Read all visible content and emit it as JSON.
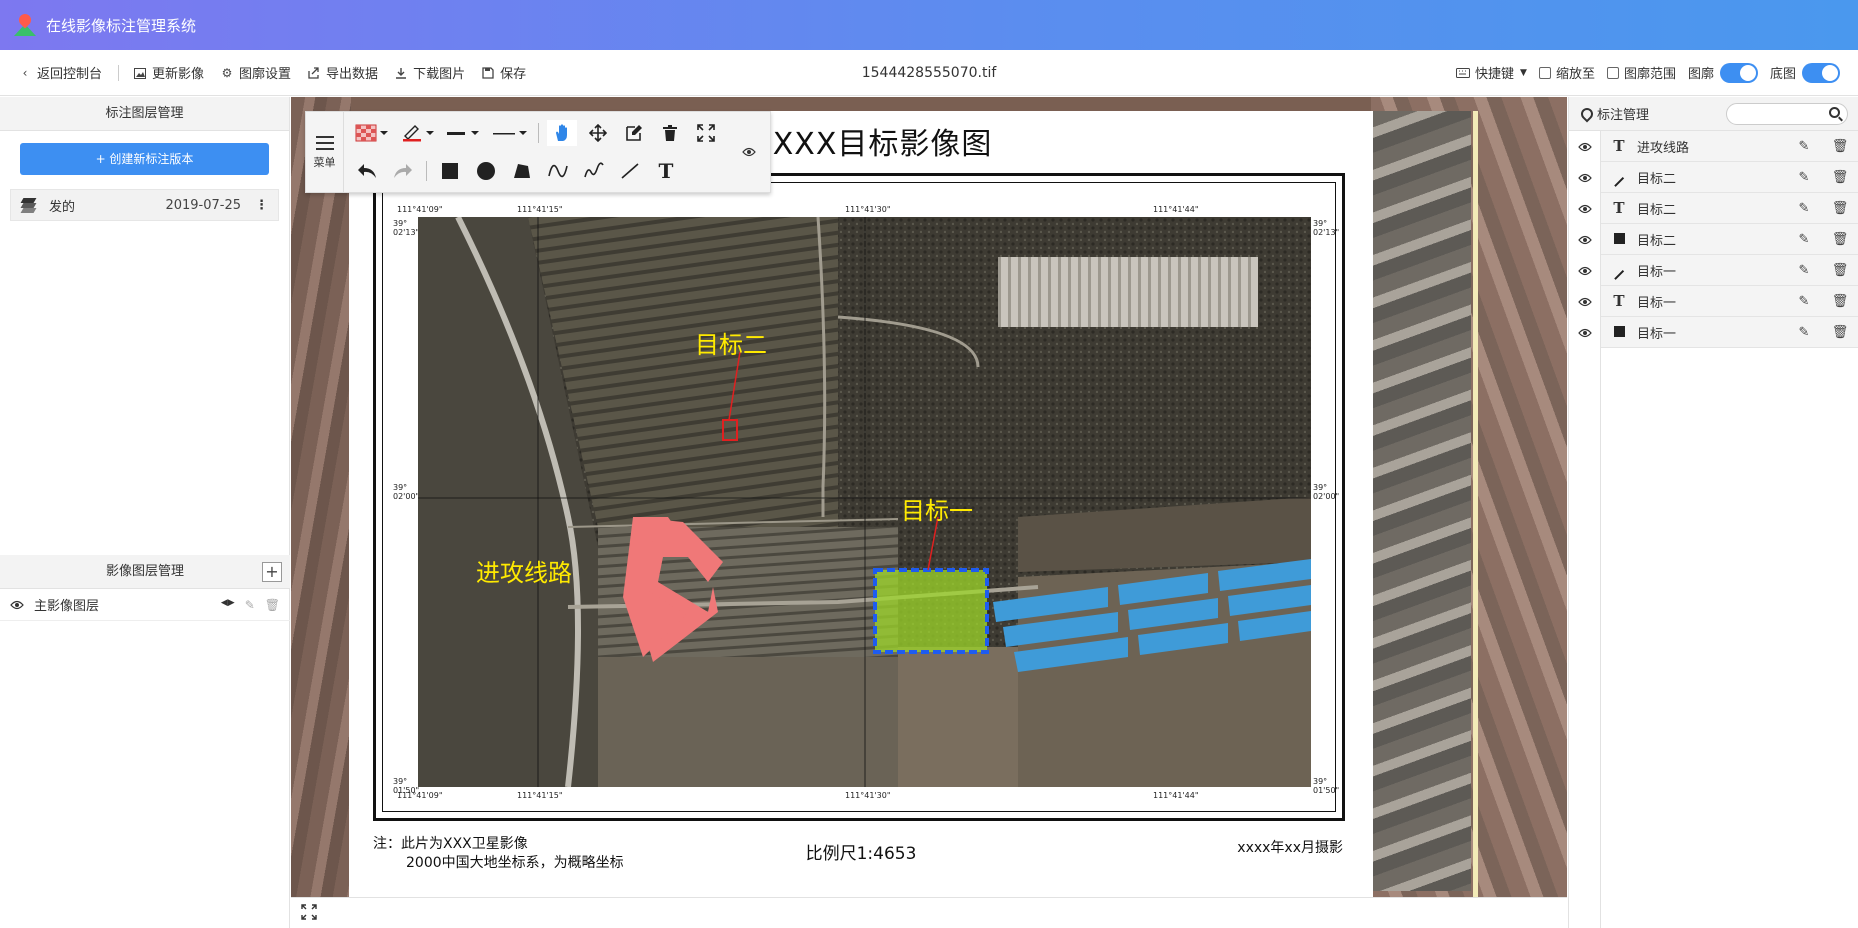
{
  "app": {
    "title": "在线影像标注管理系统"
  },
  "toolbar": {
    "back": "返回控制台",
    "update_image": "更新影像",
    "outline_settings": "图廓设置",
    "export_data": "导出数据",
    "download_image": "下载图片",
    "save": "保存",
    "filename": "1544428555070.tif",
    "shortcut": "快捷键",
    "zoom_to": "缩放至",
    "outline_range": "图廓范围",
    "outline": "图廓",
    "basemap": "底图"
  },
  "left_panel": {
    "annotation_layers_title": "标注图层管理",
    "create_version_label": "+ 创建新标注版本",
    "versions": [
      {
        "name": "发的",
        "date": "2019-07-25"
      }
    ],
    "image_layers_title": "影像图层管理",
    "add_label": "+",
    "image_layers": [
      {
        "name": "主影像图层"
      }
    ]
  },
  "draw_toolbar": {
    "menu_label": "菜单"
  },
  "map_sheet": {
    "title": "XXXXX目标影像图",
    "note_line1": "注：此片为XXX卫星影像",
    "note_line2": "2000中国大地坐标系，为概略坐标",
    "scale": "比例尺1:4653",
    "shot": "xxxx年xx月摄影",
    "coords_top": [
      "111°41'09\"",
      "111°41'15\"",
      "111°41'30\"",
      "111°41'44\""
    ],
    "coords_bottom": [
      "111°41'09\"",
      "111°41'15\"",
      "111°41'30\"",
      "111°41'44\""
    ],
    "coords_left": [
      "39°\n02'13\"",
      "39°\n02'00\"",
      "39°\n01'50\""
    ],
    "coords_right": [
      "39°\n02'13\"",
      "39°\n02'00\"",
      "39°\n01'50\""
    ],
    "labels": {
      "route": "进攻线路",
      "target2": "目标二",
      "target1": "目标一"
    }
  },
  "right_panel": {
    "title": "标注管理",
    "search_placeholder": "",
    "items": [
      {
        "type": "text",
        "name": "进攻线路"
      },
      {
        "type": "line",
        "name": "目标二"
      },
      {
        "type": "text",
        "name": "目标二"
      },
      {
        "type": "polygon",
        "name": "目标二"
      },
      {
        "type": "line",
        "name": "目标一"
      },
      {
        "type": "text",
        "name": "目标一"
      },
      {
        "type": "polygon",
        "name": "目标一"
      }
    ]
  },
  "icons": {
    "back": "chevron-left-icon",
    "update": "image-icon",
    "settings": "gear-icon",
    "export": "export-icon",
    "download": "download-icon",
    "save": "save-icon",
    "keyboard": "keyboard-icon",
    "eye": "eye-icon",
    "edit": "edit-icon",
    "trash": "trash-icon"
  },
  "colors": {
    "accent": "#3d8ff2",
    "label_yellow": "#ffea00",
    "route_red": "#f07878",
    "target_outline": "#1e5cf0"
  }
}
